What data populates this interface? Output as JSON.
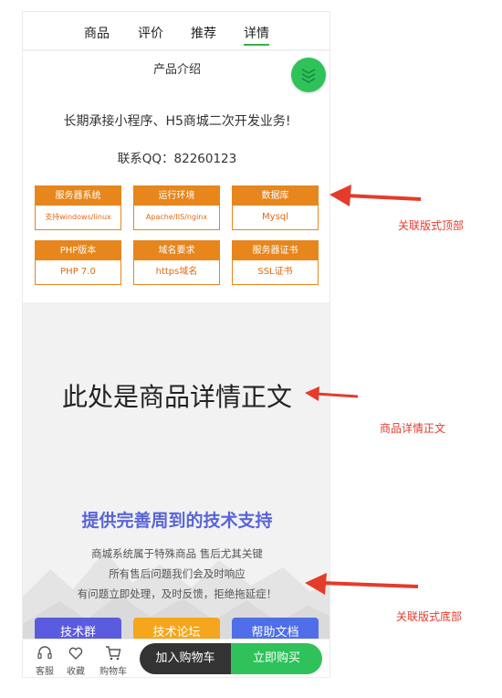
{
  "tabs": [
    {
      "label": "商品"
    },
    {
      "label": "评价"
    },
    {
      "label": "推荐"
    },
    {
      "label": "详情"
    }
  ],
  "active_tab": "详情",
  "intro": {
    "title": "产品介绍",
    "slogan": "长期承接小程序、H5商城二次开发业务!",
    "contact": "联系QQ：82260123",
    "specs": [
      {
        "label": "服务器系统",
        "value": "支持windows/linux"
      },
      {
        "label": "运行环境",
        "value": "Apache/IIS/nginx"
      },
      {
        "label": "数据库",
        "value": "Mysql"
      },
      {
        "label": "PHP版本",
        "value": "PHP 7.0"
      },
      {
        "label": "域名要求",
        "value": "https域名"
      },
      {
        "label": "服务器证书",
        "value": "SSL证书"
      }
    ]
  },
  "detail": {
    "main_text": "此处是商品详情正文"
  },
  "support": {
    "title": "提供完善周到的技术支持",
    "lines": [
      "商城系统属于特殊商品 售后尤其关键",
      "所有售后问题我们会及时响应",
      "有问题立即处理，及时反馈，拒绝拖延症！"
    ],
    "buttons": [
      {
        "label": "技术群",
        "color": "#5b5bdf"
      },
      {
        "label": "技术论坛",
        "color": "#f5a61c"
      },
      {
        "label": "帮助文档",
        "color": "#4f6ee8"
      }
    ]
  },
  "action_bar": {
    "service": "客服",
    "favorite": "收藏",
    "cart": "购物车",
    "add_to_cart": "加入购物车",
    "buy_now": "立即购买"
  },
  "annotations": {
    "top": "关联版式顶部",
    "body": "商品详情正文",
    "bottom": "关联版式底部"
  },
  "colors": {
    "accent_green": "#2fc25b",
    "spec_orange": "#e6861c",
    "annotation_red": "#e53b2b",
    "support_title": "#5965d8"
  }
}
